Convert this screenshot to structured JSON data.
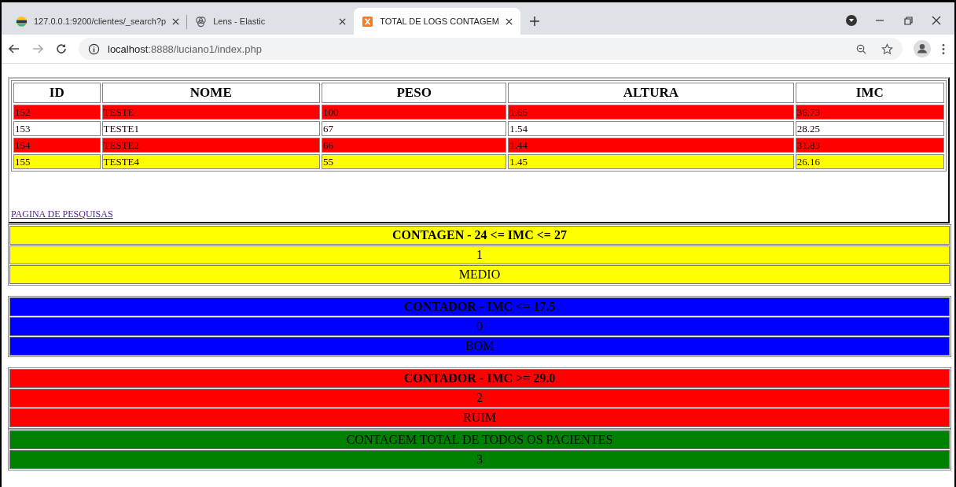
{
  "browser": {
    "tabs": [
      {
        "title": "127.0.0.1:9200/clientes/_search?p",
        "kind": "striped",
        "selected": false
      },
      {
        "title": "Lens - Elastic",
        "kind": "flower",
        "selected": false
      },
      {
        "title": "TOTAL DE LOGS CONTAGEM",
        "kind": "square",
        "selected": true
      }
    ],
    "address": {
      "host": "localhost",
      "rest": ":8888/luciano1/index.php"
    }
  },
  "table": {
    "columns": [
      "ID",
      "NOME",
      "PESO",
      "ALTURA",
      "IMC"
    ],
    "rows": [
      {
        "color": "#ff0000",
        "cells": [
          "152",
          "TESTE",
          "100",
          "1.65",
          "36.73"
        ]
      },
      {
        "color": "#ffffff",
        "cells": [
          "153",
          "TESTE1",
          "67",
          "1.54",
          "28.25"
        ]
      },
      {
        "color": "#ff0000",
        "cells": [
          "154",
          "TESTE2",
          "66",
          "1.44",
          "31.83"
        ]
      },
      {
        "color": "#ffff00",
        "cells": [
          "155",
          "TESTE4",
          "55",
          "1.45",
          "26.16"
        ]
      }
    ]
  },
  "link": "PAGINA DE PESQUISAS",
  "counter_groups": [
    [
      {
        "color": "#ffff00",
        "lines": [
          {
            "text": "CONTAGEN - 24 <= IMC <= 27",
            "bold": true
          },
          {
            "text": "1",
            "bold": false
          },
          {
            "text": "MEDIO",
            "bold": false
          }
        ]
      }
    ],
    [
      {
        "color": "#0000ff",
        "lines": [
          {
            "text": "CONTADOR - IMC <= 17.5",
            "bold": true
          },
          {
            "text": "0",
            "bold": false
          },
          {
            "text": "BOM",
            "bold": false
          }
        ]
      }
    ],
    [
      {
        "color": "#ff0000",
        "lines": [
          {
            "text": "CONTADOR - IMC >= 29.0",
            "bold": true
          },
          {
            "text": "2",
            "bold": false
          },
          {
            "text": "RUIM",
            "bold": false
          }
        ]
      },
      {
        "color": "#008000",
        "lines": [
          {
            "text": "CONTAGEM TOTAL DE TODOS OS PACIENTES",
            "bold": false
          },
          {
            "text": "3",
            "bold": false
          }
        ]
      }
    ]
  ]
}
